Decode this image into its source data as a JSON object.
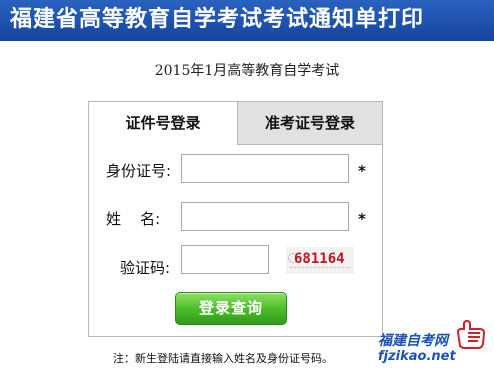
{
  "header": {
    "title": "福建省高等教育自学考试考试通知单打印"
  },
  "exam_title": "2015年1月高等教育自学考试",
  "tabs": [
    {
      "label": "证件号登录",
      "active": true
    },
    {
      "label": "准考证号登录",
      "active": false
    }
  ],
  "form": {
    "id_label": "身份证号:",
    "id_value": "",
    "name_label": "姓    名:",
    "name_value": "",
    "captcha_label": "验证码:",
    "captcha_value": "",
    "required_mark": "*",
    "captcha_code": "681164"
  },
  "login_button": "登录查询",
  "note": "注：新生登陆请直接输入姓名及身份证号码。",
  "watermark": {
    "site": "福建自考网",
    "domain": "fjzikao.net"
  },
  "colors": {
    "header": "#1b4fae",
    "button": "#4cbe2c",
    "captcha_text": "#c0141e",
    "watermark": "#1d52b4"
  }
}
